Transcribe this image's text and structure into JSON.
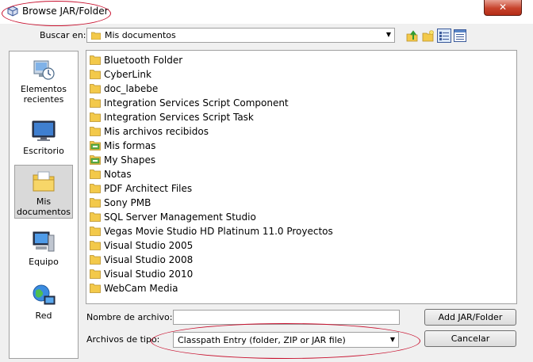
{
  "window": {
    "title": "Browse JAR/Folder",
    "close_glyph": "✕"
  },
  "lookin": {
    "label": "Buscar en:",
    "value": "Mis documentos"
  },
  "toolbar_icons": [
    "up-one-level-icon",
    "new-folder-icon",
    "list-view-icon",
    "details-view-icon"
  ],
  "places": [
    {
      "label": "Elementos recientes",
      "icon": "recent-items-icon"
    },
    {
      "label": "Escritorio",
      "icon": "desktop-icon"
    },
    {
      "label": "Mis documentos",
      "icon": "my-documents-icon"
    },
    {
      "label": "Equipo",
      "icon": "computer-icon"
    },
    {
      "label": "Red",
      "icon": "network-icon"
    }
  ],
  "files": [
    {
      "name": "Bluetooth Folder",
      "icon": "folder-icon"
    },
    {
      "name": "CyberLink",
      "icon": "folder-icon"
    },
    {
      "name": "doc_labebe",
      "icon": "folder-icon"
    },
    {
      "name": "Integration Services Script Component",
      "icon": "folder-icon"
    },
    {
      "name": "Integration Services Script Task",
      "icon": "folder-icon"
    },
    {
      "name": "Mis archivos recibidos",
      "icon": "folder-icon"
    },
    {
      "name": "Mis formas",
      "icon": "special-folder-icon"
    },
    {
      "name": "My Shapes",
      "icon": "special-folder-icon"
    },
    {
      "name": "Notas",
      "icon": "folder-icon"
    },
    {
      "name": "PDF Architect Files",
      "icon": "folder-icon"
    },
    {
      "name": "Sony PMB",
      "icon": "folder-icon"
    },
    {
      "name": "SQL Server Management Studio",
      "icon": "folder-icon"
    },
    {
      "name": "Vegas Movie Studio HD Platinum 11.0 Proyectos",
      "icon": "folder-icon"
    },
    {
      "name": "Visual Studio 2005",
      "icon": "folder-icon"
    },
    {
      "name": "Visual Studio 2008",
      "icon": "folder-icon"
    },
    {
      "name": "Visual Studio 2010",
      "icon": "folder-icon"
    },
    {
      "name": "WebCam Media",
      "icon": "folder-icon"
    }
  ],
  "filename": {
    "label": "Nombre de archivo:",
    "value": ""
  },
  "filetype": {
    "label": "Archivos de tipo:",
    "value": "Classpath Entry (folder, ZIP or JAR file)"
  },
  "buttons": {
    "add": "Add JAR/Folder",
    "cancel": "Cancelar"
  },
  "colors": {
    "annotation": "#c8102e",
    "folder": "#f3c94a",
    "close": "#c7432c"
  }
}
